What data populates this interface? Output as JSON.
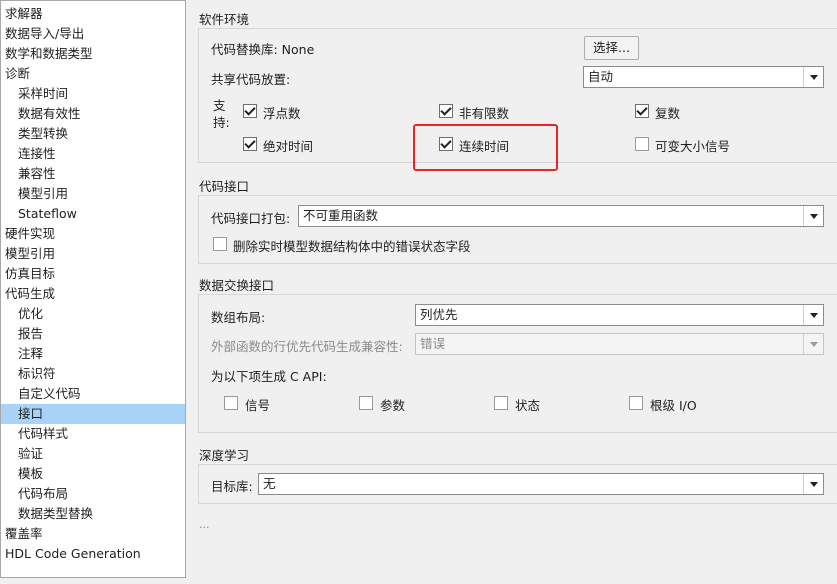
{
  "tree": {
    "items": [
      {
        "label": "求解器"
      },
      {
        "label": "数据导入/导出"
      },
      {
        "label": "数学和数据类型"
      },
      {
        "label": "诊断"
      },
      {
        "label": "采样时间"
      },
      {
        "label": "数据有效性"
      },
      {
        "label": "类型转换"
      },
      {
        "label": "连接性"
      },
      {
        "label": "兼容性"
      },
      {
        "label": "模型引用"
      },
      {
        "label": "Stateflow"
      },
      {
        "label": "硬件实现"
      },
      {
        "label": "模型引用"
      },
      {
        "label": "仿真目标"
      },
      {
        "label": "代码生成"
      },
      {
        "label": "优化"
      },
      {
        "label": "报告"
      },
      {
        "label": "注释"
      },
      {
        "label": "标识符"
      },
      {
        "label": "自定义代码"
      },
      {
        "label": "接口"
      },
      {
        "label": "代码样式"
      },
      {
        "label": "验证"
      },
      {
        "label": "模板"
      },
      {
        "label": "代码布局"
      },
      {
        "label": "数据类型替换"
      },
      {
        "label": "覆盖率"
      },
      {
        "label": "HDL Code Generation"
      }
    ],
    "selected": "接口"
  },
  "software_env": {
    "title": "软件环境",
    "code_replacement_label": "代码替换库: None",
    "select_button": "选择...",
    "shared_code_label": "共享代码放置:",
    "shared_code_value": "自动",
    "support_label_1": "支",
    "support_label_2": "持:",
    "checkboxes": {
      "floating_point": {
        "label": "浮点数",
        "checked": true
      },
      "non_finite": {
        "label": "非有限数",
        "checked": true
      },
      "complex": {
        "label": "复数",
        "checked": true
      },
      "absolute_time": {
        "label": "绝对时间",
        "checked": true
      },
      "continuous_time": {
        "label": "连续时间",
        "checked": true
      },
      "variable_size": {
        "label": "可变大小信号",
        "checked": false
      }
    }
  },
  "code_interface": {
    "title": "代码接口",
    "packaging_label": "代码接口打包:",
    "packaging_value": "不可重用函数",
    "remove_error_field": {
      "label": "删除实时模型数据结构体中的错误状态字段",
      "checked": false
    }
  },
  "data_exchange": {
    "title": "数据交换接口",
    "array_layout_label": "数组布局:",
    "array_layout_value": "列优先",
    "row_major_label": "外部函数的行优先代码生成兼容性:",
    "row_major_value": "错误",
    "c_api_label": "为以下项生成 C API:",
    "checkboxes": {
      "signals": {
        "label": "信号",
        "checked": false
      },
      "parameters": {
        "label": "参数",
        "checked": false
      },
      "states": {
        "label": "状态",
        "checked": false
      },
      "root_io": {
        "label": "根级 I/O",
        "checked": false
      }
    }
  },
  "deep_learning": {
    "title": "深度学习",
    "target_lib_label": "目标库:",
    "target_lib_value": "无"
  },
  "more_indicator": "...",
  "highlight_color": "#e8262a",
  "selection_color": "#a8d3f7"
}
